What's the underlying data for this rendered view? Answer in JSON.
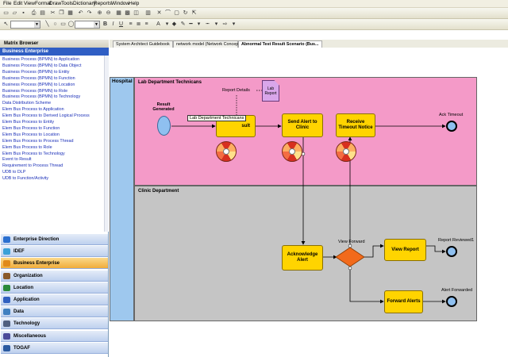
{
  "menu": [
    "File",
    "Edit",
    "View",
    "Format",
    "Draw",
    "Tools",
    "Dictionary",
    "Reports",
    "Window",
    "Help"
  ],
  "toolbar": {
    "font_name": "",
    "font_size": ""
  },
  "tabs": [
    {
      "label": "System Architect Guidebook",
      "active": false
    },
    {
      "label": "network model (Network Concept)",
      "active": false
    },
    {
      "label": "Abnormal Test Result Scenario (Bus...",
      "active": true
    }
  ],
  "browser": {
    "title": "Matrix Browser",
    "selected": "Business Enterprise",
    "items": [
      "Business Process (BPMN) to Application",
      "Business Process (BPMN) to Data Object",
      "Business Process (BPMN) to Entity",
      "Business Process (BPMN) to Function",
      "Business Process (BPMN) to Location",
      "Business Process (BPMN) to Role",
      "Business Process (BPMN) to Technology",
      "Data Distribution Scheme",
      "Elem Bus Process to Application",
      "Elem Bus Process to Derived Logical Process",
      "Elem Bus Process to Entity",
      "Elem Bus Process to Function",
      "Elem Bus Process to Location",
      "Elem Bus Process to Process Thread",
      "Elem Bus Process to Role",
      "Elem Bus Process to Technology",
      "Event to Result",
      "Requirement to Process Thread",
      "UDB to DLP",
      "UDB to Function/Activity"
    ],
    "categories": [
      {
        "label": "Enterprise Direction",
        "color": "#2a6fd0",
        "active": false
      },
      {
        "label": "IDEF",
        "color": "#3aa0d8",
        "active": false
      },
      {
        "label": "Business Enterprise",
        "color": "#e08a1a",
        "active": true
      },
      {
        "label": "Organization",
        "color": "#8a5a2a",
        "active": false
      },
      {
        "label": "Location",
        "color": "#2a8a3a",
        "active": false
      },
      {
        "label": "Application",
        "color": "#3060c0",
        "active": false
      },
      {
        "label": "Data",
        "color": "#4080c0",
        "active": false
      },
      {
        "label": "Technology",
        "color": "#506080",
        "active": false
      },
      {
        "label": "Miscellaneous",
        "color": "#4a4a9a",
        "active": false
      },
      {
        "label": "TOGAF",
        "color": "#2a5aa0",
        "active": false
      }
    ]
  },
  "diagram": {
    "pool": "Hospital",
    "lane1_title": "Lab Department Technicans",
    "lane2_title": "Clinic Department",
    "start_event_label": "Result\nGenerated",
    "task1_partial": "sult",
    "tooltip": "Lab Department Technicans",
    "annotation_label": "Report Details",
    "data_object": "Lab\nReport",
    "task_send_alert": "Send Alert to\nClinic",
    "task_receive": "Receive\nTimeout Notice",
    "end_ack_timeout": "Ack Timeout",
    "task_acknowledge": "Acknowledge\nAlert",
    "gateway_label": "View Forward",
    "task_view_report": "View Report",
    "end_report_reviewed": "Report Reviewed1",
    "task_forward_alerts": "Forward Alerts",
    "end_alert_forwarded": "Alert Forwarded",
    "colors": {
      "lane1": "#f49ac8",
      "lane2": "#c5c5c5",
      "pool": "#9ec8ee",
      "task": "#ffd400",
      "gateway": "#f26a1b",
      "event": "#8fc0f0"
    }
  }
}
